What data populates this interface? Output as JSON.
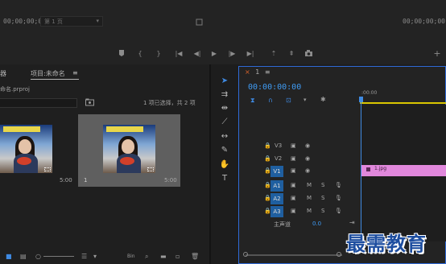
{
  "monitor": {
    "timecode_left": "00;00;00;00",
    "page_select_label": "第 1 页",
    "timecode_right": "00;00;00;00",
    "controls": [
      "marker-icon",
      "in-point-icon",
      "out-point-icon",
      "go-to-in-icon",
      "step-back-icon",
      "play-icon",
      "step-forward-icon",
      "go-to-out-icon",
      "lift-icon",
      "extract-icon",
      "export-frame-icon"
    ],
    "add_button": "+"
  },
  "project_panel": {
    "tab_left_fragment": "器",
    "tab_active": "项目:未命名",
    "tab_menu": "≡",
    "file_name": "命名.prproj",
    "selection_status": "1 项已选择，共 2 项",
    "clips": [
      {
        "name": "",
        "duration": "5:00",
        "selected": false
      },
      {
        "name": "1",
        "duration": "5:00",
        "selected": true
      }
    ],
    "bottom_icons": [
      "list-view-icon",
      "icon-view-icon",
      "freeform-view-icon",
      "zoom-slider-icon",
      "sort-icon",
      "automate-icon",
      "find-icon",
      "new-bin-icon",
      "new-item-icon",
      "delete-icon"
    ],
    "bottom_bin_label": "Bin"
  },
  "tools": [
    "selection-tool-icon",
    "track-select-icon",
    "ripple-edit-icon",
    "razor-tool-icon",
    "slip-tool-icon",
    "pen-tool-icon",
    "hand-tool-icon",
    "type-tool-icon"
  ],
  "timeline": {
    "sequence_close": "×",
    "sequence_name": "1",
    "sequence_menu": "≡",
    "timecode": "00:00:00:00",
    "ruler_label": ":00:00",
    "tracks": [
      {
        "name": "V3",
        "type": "video",
        "targeted": false
      },
      {
        "name": "V2",
        "type": "video",
        "targeted": false
      },
      {
        "name": "V1",
        "type": "video",
        "targeted": true
      },
      {
        "name": "A1",
        "type": "audio",
        "targeted": true
      },
      {
        "name": "A2",
        "type": "audio",
        "targeted": true
      },
      {
        "name": "A3",
        "type": "audio",
        "targeted": true
      }
    ],
    "clip_label": "1.jpg",
    "master_label": "主声道",
    "master_value": "0.0",
    "mute_label": "M",
    "solo_label": "S"
  },
  "watermark": "最需教育"
}
